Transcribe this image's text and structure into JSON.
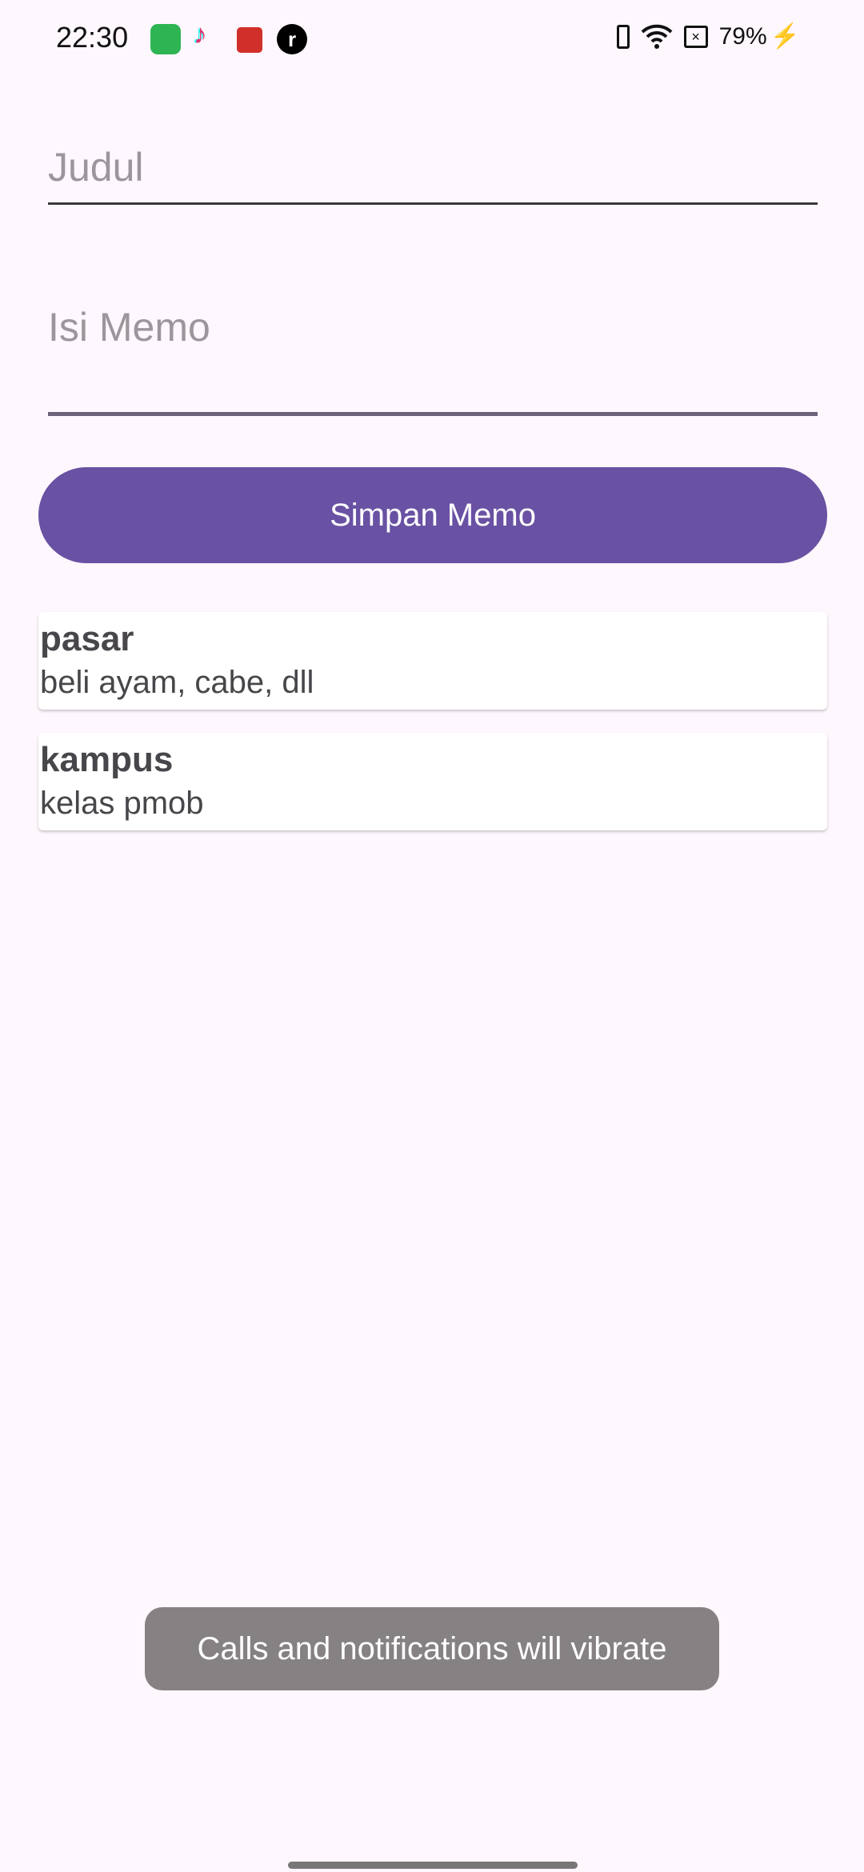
{
  "status_bar": {
    "time": "22:30",
    "battery": "79%",
    "notification_icons": [
      "store-icon",
      "tiktok-icon",
      "shopping-bag-icon",
      "r-app-icon"
    ],
    "system_icons": [
      "vibrate-icon",
      "wifi-icon",
      "no-sim-icon",
      "battery-charging-icon"
    ]
  },
  "form": {
    "title_placeholder": "Judul",
    "content_placeholder": "Isi Memo",
    "save_label": "Simpan Memo"
  },
  "memos": [
    {
      "title": "pasar",
      "body": "beli ayam, cabe, dll"
    },
    {
      "title": "kampus",
      "body": "kelas pmob"
    }
  ],
  "toast": "Calls and notifications will vibrate",
  "colors": {
    "accent": "#6951a3",
    "background": "#fef7fd"
  }
}
